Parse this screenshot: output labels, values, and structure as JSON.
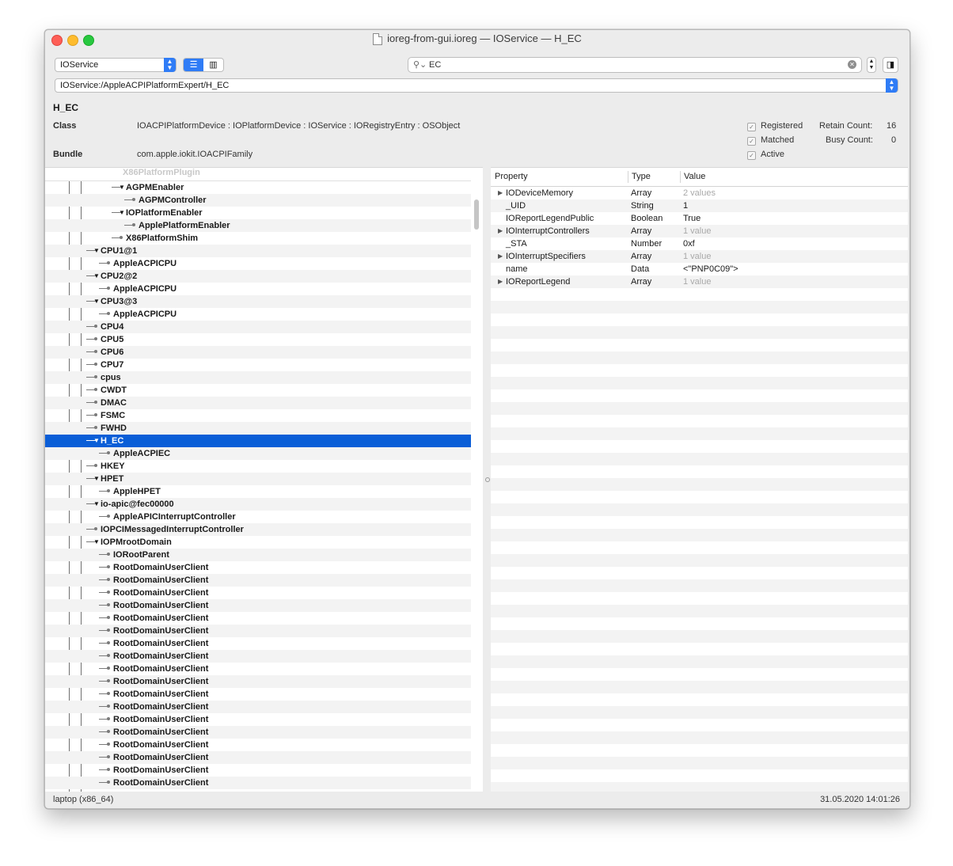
{
  "window": {
    "title": "ioreg-from-gui.ioreg — IOService — H_EC"
  },
  "toolbar": {
    "plane": "IOService",
    "search_value": "EC",
    "path": "IOService:/AppleACPIPlatformExpert/H_EC"
  },
  "inspector": {
    "name": "H_EC",
    "class_label": "Class",
    "class_value": "IOACPIPlatformDevice : IOPlatformDevice : IOService : IORegistryEntry : OSObject",
    "bundle_label": "Bundle",
    "bundle_value": "com.apple.iokit.IOACPIFamily",
    "registered": "Registered",
    "matched": "Matched",
    "active": "Active",
    "retain_label": "Retain Count:",
    "retain_value": "16",
    "busy_label": "Busy Count:",
    "busy_value": "0"
  },
  "tree": {
    "header_faded": "X86PlatformPlugin",
    "rows": [
      {
        "label": "AGPMEnabler",
        "depth": 5,
        "disc": "▼"
      },
      {
        "label": "AGPMController",
        "depth": 6,
        "disc": ""
      },
      {
        "label": "IOPlatformEnabler",
        "depth": 5,
        "disc": "▼"
      },
      {
        "label": "ApplePlatformEnabler",
        "depth": 6,
        "disc": ""
      },
      {
        "label": "X86PlatformShim",
        "depth": 5,
        "disc": ""
      },
      {
        "label": "CPU1@1",
        "depth": 3,
        "disc": "▼"
      },
      {
        "label": "AppleACPICPU",
        "depth": 4,
        "disc": ""
      },
      {
        "label": "CPU2@2",
        "depth": 3,
        "disc": "▼"
      },
      {
        "label": "AppleACPICPU",
        "depth": 4,
        "disc": ""
      },
      {
        "label": "CPU3@3",
        "depth": 3,
        "disc": "▼"
      },
      {
        "label": "AppleACPICPU",
        "depth": 4,
        "disc": ""
      },
      {
        "label": "CPU4",
        "depth": 3,
        "disc": ""
      },
      {
        "label": "CPU5",
        "depth": 3,
        "disc": ""
      },
      {
        "label": "CPU6",
        "depth": 3,
        "disc": ""
      },
      {
        "label": "CPU7",
        "depth": 3,
        "disc": ""
      },
      {
        "label": "cpus",
        "depth": 3,
        "disc": ""
      },
      {
        "label": "CWDT",
        "depth": 3,
        "disc": ""
      },
      {
        "label": "DMAC",
        "depth": 3,
        "disc": ""
      },
      {
        "label": "FSMC",
        "depth": 3,
        "disc": ""
      },
      {
        "label": "FWHD",
        "depth": 3,
        "disc": ""
      },
      {
        "label": "H_EC",
        "depth": 3,
        "disc": "▼",
        "selected": true
      },
      {
        "label": "AppleACPIEC",
        "depth": 4,
        "disc": ""
      },
      {
        "label": "HKEY",
        "depth": 3,
        "disc": ""
      },
      {
        "label": "HPET",
        "depth": 3,
        "disc": "▼"
      },
      {
        "label": "AppleHPET",
        "depth": 4,
        "disc": ""
      },
      {
        "label": "io-apic@fec00000",
        "depth": 3,
        "disc": "▼"
      },
      {
        "label": "AppleAPICInterruptController",
        "depth": 4,
        "disc": ""
      },
      {
        "label": "IOPCIMessagedInterruptController",
        "depth": 3,
        "disc": ""
      },
      {
        "label": "IOPMrootDomain",
        "depth": 3,
        "disc": "▼"
      },
      {
        "label": "IORootParent",
        "depth": 4,
        "disc": ""
      },
      {
        "label": "RootDomainUserClient",
        "depth": 4,
        "disc": ""
      },
      {
        "label": "RootDomainUserClient",
        "depth": 4,
        "disc": ""
      },
      {
        "label": "RootDomainUserClient",
        "depth": 4,
        "disc": ""
      },
      {
        "label": "RootDomainUserClient",
        "depth": 4,
        "disc": ""
      },
      {
        "label": "RootDomainUserClient",
        "depth": 4,
        "disc": ""
      },
      {
        "label": "RootDomainUserClient",
        "depth": 4,
        "disc": ""
      },
      {
        "label": "RootDomainUserClient",
        "depth": 4,
        "disc": ""
      },
      {
        "label": "RootDomainUserClient",
        "depth": 4,
        "disc": ""
      },
      {
        "label": "RootDomainUserClient",
        "depth": 4,
        "disc": ""
      },
      {
        "label": "RootDomainUserClient",
        "depth": 4,
        "disc": ""
      },
      {
        "label": "RootDomainUserClient",
        "depth": 4,
        "disc": ""
      },
      {
        "label": "RootDomainUserClient",
        "depth": 4,
        "disc": ""
      },
      {
        "label": "RootDomainUserClient",
        "depth": 4,
        "disc": ""
      },
      {
        "label": "RootDomainUserClient",
        "depth": 4,
        "disc": ""
      },
      {
        "label": "RootDomainUserClient",
        "depth": 4,
        "disc": ""
      },
      {
        "label": "RootDomainUserClient",
        "depth": 4,
        "disc": ""
      },
      {
        "label": "RootDomainUserClient",
        "depth": 4,
        "disc": ""
      },
      {
        "label": "RootDomainUserClient",
        "depth": 4,
        "disc": ""
      }
    ]
  },
  "properties": {
    "columns": [
      "Property",
      "Type",
      "Value"
    ],
    "rows": [
      {
        "name": "IODeviceMemory",
        "type": "Array",
        "value": "2 values",
        "expandable": true,
        "muted": true
      },
      {
        "name": "_UID",
        "type": "String",
        "value": "1",
        "expandable": false,
        "muted": false
      },
      {
        "name": "IOReportLegendPublic",
        "type": "Boolean",
        "value": "True",
        "expandable": false,
        "muted": false
      },
      {
        "name": "IOInterruptControllers",
        "type": "Array",
        "value": "1 value",
        "expandable": true,
        "muted": true
      },
      {
        "name": "_STA",
        "type": "Number",
        "value": "0xf",
        "expandable": false,
        "muted": false
      },
      {
        "name": "IOInterruptSpecifiers",
        "type": "Array",
        "value": "1 value",
        "expandable": true,
        "muted": true
      },
      {
        "name": "name",
        "type": "Data",
        "value": "<\"PNP0C09\">",
        "expandable": false,
        "muted": false
      },
      {
        "name": "IOReportLegend",
        "type": "Array",
        "value": "1 value",
        "expandable": true,
        "muted": true
      }
    ]
  },
  "status": {
    "left": "laptop (x86_64)",
    "right": "31.05.2020 14:01:26"
  },
  "colors": {
    "selection": "#0a5ed7",
    "accent": "#2f7cf6"
  }
}
